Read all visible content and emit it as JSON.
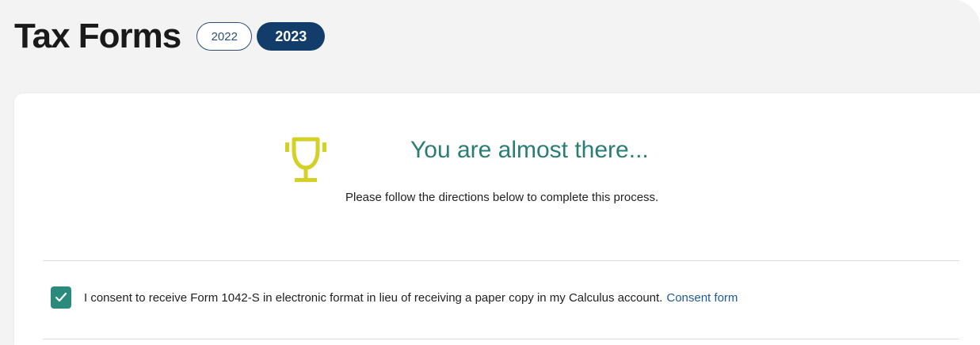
{
  "header": {
    "title": "Tax Forms",
    "years": [
      {
        "label": "2022",
        "selected": false
      },
      {
        "label": "2023",
        "selected": true
      }
    ]
  },
  "main": {
    "icon": "trophy-icon",
    "heading": "You are almost there...",
    "subtext": "Please follow the directions below to complete this process.",
    "consent": {
      "checked": true,
      "text": "I consent to receive Form 1042-S in electronic format in lieu of receiving a paper copy in my Calculus account.",
      "link_label": "Consent form"
    }
  },
  "colors": {
    "heading": "#2a7d75",
    "accent_checkbox": "#2a8a7c",
    "trophy": "#d4d026",
    "active_pill": "#123d6b",
    "link": "#1d5a9a"
  }
}
